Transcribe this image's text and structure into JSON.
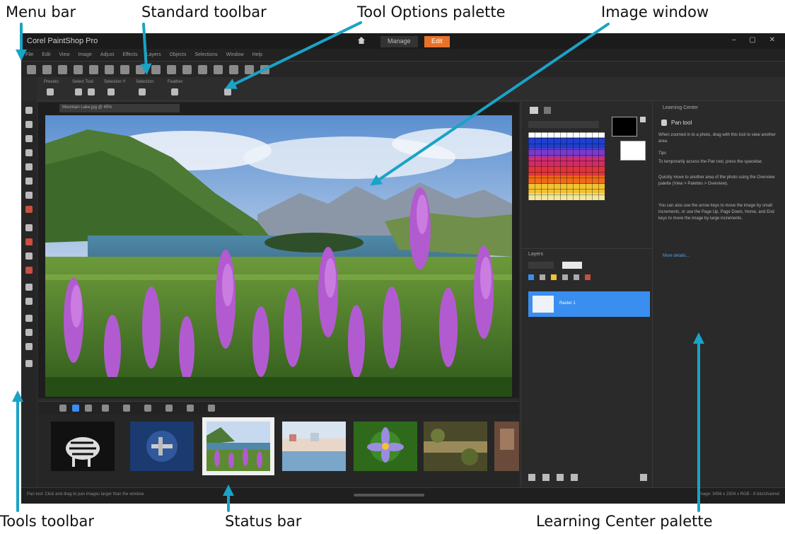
{
  "callouts": {
    "menu_bar": "Menu bar",
    "standard_toolbar": "Standard toolbar",
    "tool_options_palette": "Tool Options palette",
    "image_window": "Image window",
    "tools_toolbar": "Tools toolbar",
    "status_bar": "Status bar",
    "learning_center_palette": "Learning Center palette"
  },
  "app": {
    "title": "Corel PaintShop Pro",
    "workspace_tabs": [
      "Manage",
      "Edit"
    ],
    "active_tab": "Edit"
  },
  "menu": [
    "File",
    "Edit",
    "View",
    "Image",
    "Adjust",
    "Effects",
    "Layers",
    "Objects",
    "Selections",
    "Window",
    "Help"
  ],
  "tool_options": {
    "labels": [
      "Presets:",
      "Select Tool:",
      "Selection Y:",
      "Selection:",
      "Feather:"
    ]
  },
  "image_window": {
    "tab_label": "Mountain Lake.jpg @ 45%"
  },
  "layers": {
    "title": "Layers",
    "layer_name": "Raster 1"
  },
  "learning_center": {
    "title": "Learning Center",
    "tool_name": "Pan tool",
    "intro": "When zoomed in to a photo, drag with this tool to view another area.",
    "tips_heading": "Tips",
    "tip1": "To temporarily access the Pan tool, press the spacebar.",
    "tip2": "Quickly move to another area of the photo using the Overview palette (View > Palettes > Overview).",
    "tip3": "You can also use the arrow keys to move the image by small increments, or use the Page Up, Page Down, Home, and End keys to move the image by large increments.",
    "link": "More details..."
  },
  "status": {
    "left": "Pan tool: Click and drag to pan images larger than the window.",
    "right": "Image: 3456 x 2304 x RGB - 8 bits/channel"
  },
  "colors": {
    "callout_arrow": "#1aa3c6",
    "active_tab": "#e8722c",
    "layer_selected": "#3a8ef0",
    "app_bg": "#2a2a2a"
  }
}
